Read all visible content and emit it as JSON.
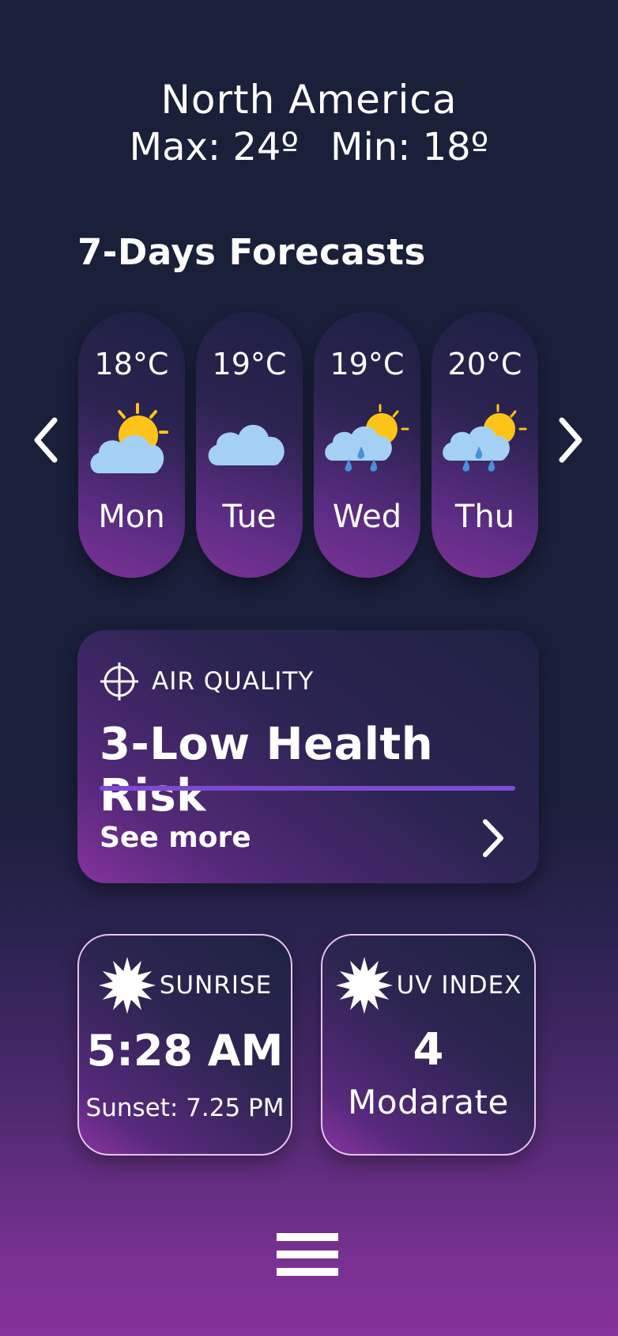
{
  "header": {
    "location": "North America",
    "max": "Max: 24º",
    "min": "Min: 18º"
  },
  "forecast": {
    "title": "7-Days Forecasts",
    "days": [
      {
        "temp": "18°C",
        "day": "Mon",
        "icon": "sun-behind-cloud-icon"
      },
      {
        "temp": "19°C",
        "day": "Tue",
        "icon": "cloud-icon"
      },
      {
        "temp": "19°C",
        "day": "Wed",
        "icon": "sun-cloud-rain-icon"
      },
      {
        "temp": "20°C",
        "day": "Thu",
        "icon": "sun-cloud-rain-icon"
      }
    ],
    "prev_icon": "chevron-left-icon",
    "next_icon": "chevron-right-icon"
  },
  "air_quality": {
    "label": "AIR QUALITY",
    "value": "3-Low Health Risk",
    "see_more": "See more",
    "icon": "crosshair-icon"
  },
  "sunrise": {
    "label": "SUNRISE",
    "time": "5:28 AM",
    "sunset": "Sunset: 7.25 PM",
    "icon": "sun-icon"
  },
  "uv": {
    "label": "UV INDEX",
    "value": "4",
    "level": "Modarate",
    "icon": "sun-icon"
  },
  "colors": {
    "background_top": "#1a1f3a",
    "background_bottom": "#86329c",
    "accent_line": "#7d4bd0",
    "sun": "#fcc419",
    "cloud": "#a5d0f5",
    "rain": "#4a90d9"
  },
  "menu_icon": "hamburger-menu-icon"
}
